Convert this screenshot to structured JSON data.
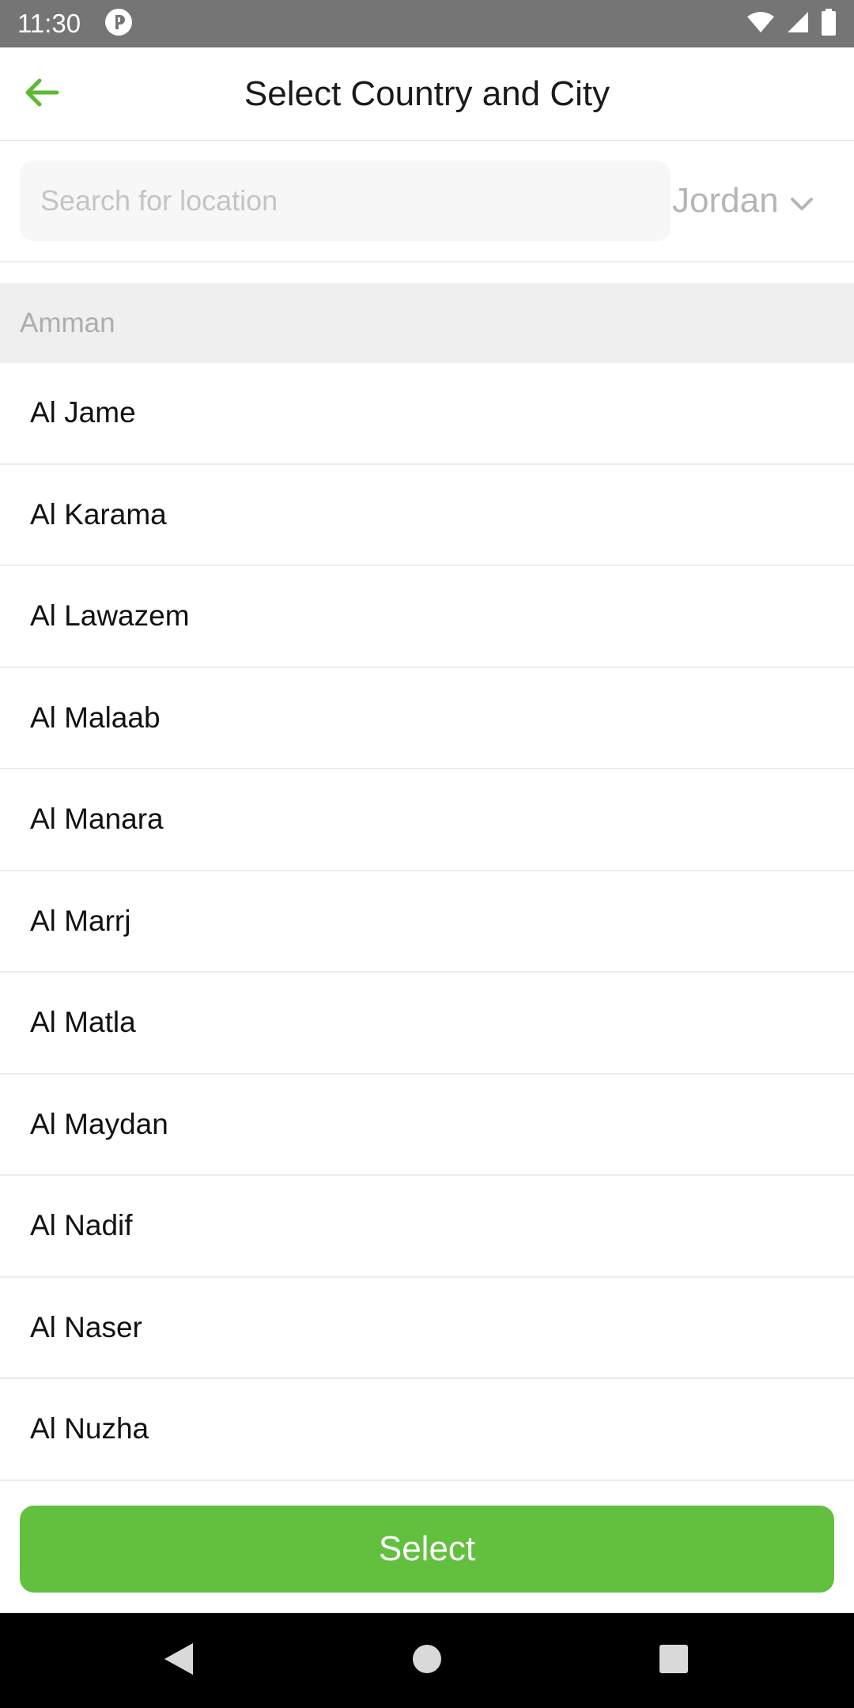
{
  "status_bar": {
    "time": "11:30",
    "icons": [
      "app-notification-icon",
      "wifi-icon",
      "signal-icon",
      "battery-icon"
    ]
  },
  "app_bar": {
    "title": "Select Country and City",
    "back_icon": "arrow-left-icon",
    "accent_color": "#5cb934"
  },
  "search": {
    "placeholder": "Search for location",
    "value": ""
  },
  "country_selector": {
    "selected": "Jordan",
    "icon": "chevron-down-icon"
  },
  "section": {
    "header": "Amman"
  },
  "cities": [
    "Al Jame",
    "Al Karama",
    "Al Lawazem",
    "Al Malaab",
    "Al Manara",
    "Al Marrj",
    "Al Matla",
    "Al Maydan",
    "Al Nadif",
    "Al Naser",
    "Al Nuzha"
  ],
  "actions": {
    "select_label": "Select",
    "button_color": "#63c03f"
  },
  "nav_bar": {
    "icons": [
      "back-triangle-icon",
      "home-circle-icon",
      "recents-square-icon"
    ]
  }
}
